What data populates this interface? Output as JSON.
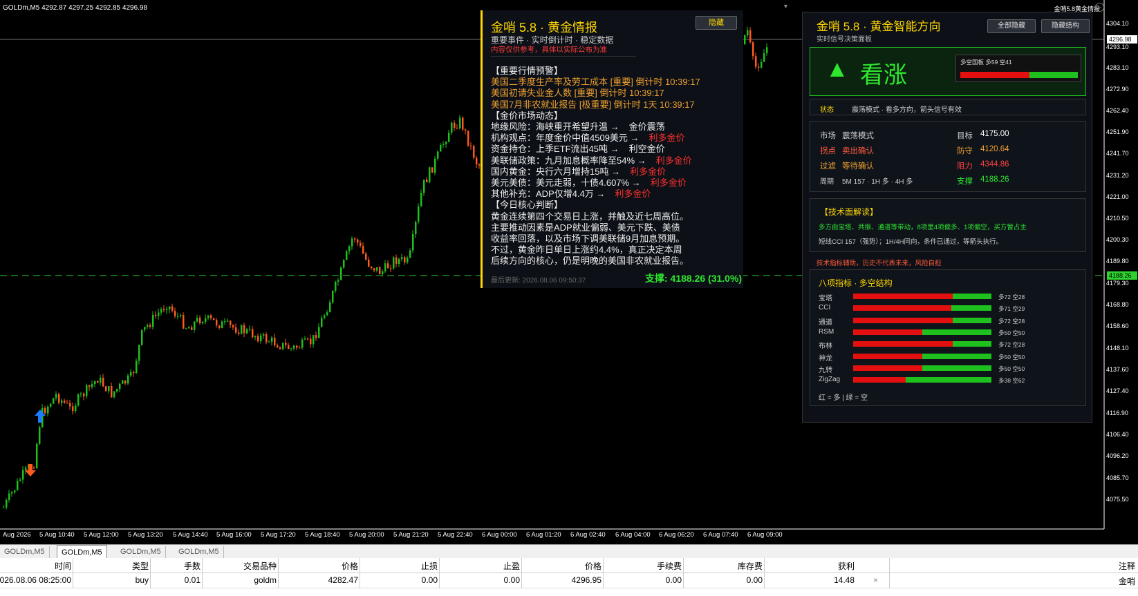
{
  "chart": {
    "symbol_info": "GOLDm,M5  4292.87 4297.25 4292.85 4296.98",
    "top_right_label": "金哨5.8黄金情报",
    "price_axis": [
      "4304.10",
      "4296.98",
      "4293.10",
      "4283.10",
      "4272.90",
      "4262.40",
      "4251.90",
      "4241.70",
      "4231.20",
      "4221.00",
      "4210.50",
      "4200.30",
      "4189.80",
      "4179.30",
      "4168.80",
      "4158.60",
      "4148.10",
      "4137.60",
      "4127.40",
      "4116.90",
      "4106.40",
      "4096.20",
      "4085.70",
      "4075.50"
    ],
    "current_price": "4296.98",
    "support_price_tag": "4188.26",
    "time_axis": [
      "Aug 2026",
      "5 Aug 10:40",
      "5 Aug 12:00",
      "5 Aug 13:20",
      "5 Aug 14:40",
      "5 Aug 16:00",
      "5 Aug 17:20",
      "5 Aug 18:40",
      "5 Aug 20:00",
      "5 Aug 21:20",
      "5 Aug 22:40",
      "6 Aug 00:00",
      "6 Aug 01:20",
      "6 Aug 02:40",
      "6 Aug 04:00",
      "6 Aug 06:20",
      "6 Aug 07:40",
      "6 Aug 09:00"
    ],
    "colors": {
      "bull": "#1ec01e",
      "bear": "#ff5a1e",
      "support": "#2ed12e"
    }
  },
  "news_panel": {
    "title": "金哨 5.8 · 黄金情报",
    "subtitle": "重要事件 · 实时倒计时 · 稳定数据",
    "warning": "内容仅供参考，具体以实际公布为准",
    "hide_button": "隐藏",
    "alert_header": "【重要行情预警】",
    "alerts": [
      "美国二季度生产率及劳工成本 [重要] 倒计时 10:39:17",
      "美国初请失业金人数 [重要] 倒计时 10:39:17",
      "美国7月非农就业报告 [极重要] 倒计时 1天 10:39:17"
    ],
    "market_header": "【金价市场动态】",
    "market": [
      {
        "text": "地缘风险：海峡重开希望升温  →",
        "impact": "金价震荡",
        "impact_color": "w"
      },
      {
        "text": "机构观点：年度金价中值4509美元  →",
        "impact": "利多金价",
        "impact_color": "r"
      },
      {
        "text": "资金持仓：上季ETF流出45吨  →",
        "impact": "利空金价",
        "impact_color": "g"
      },
      {
        "text": "美联储政策：九月加息概率降至54%  →",
        "impact": "利多金价",
        "impact_color": "r"
      },
      {
        "text": "国内黄金：央行六月增持15吨  →",
        "impact": "利多金价",
        "impact_color": "r"
      },
      {
        "text": "美元美债：美元走弱，十债4.607%  →",
        "impact": "利多金价",
        "impact_color": "r"
      },
      {
        "text": "其他补充：ADP仅增4.4万  →",
        "impact": "利多金价",
        "impact_color": "r"
      }
    ],
    "core_header": "【今日核心判断】",
    "core": [
      "黄金连续第四个交易日上涨，并触及近七周高位。",
      "主要推动因素是ADP就业偏弱、美元下跌、美债",
      "收益率回落，以及市场下调美联储9月加息预期。",
      "不过，黄金昨日单日上涨约4.4%，真正决定本周",
      "后续方向的核心，仍是明晚的美国非农就业报告。"
    ],
    "last_update": "最后更新: 2026.08.06 09:50:37",
    "support": "支撑: 4188.26 (31.0%)"
  },
  "signal_panel": {
    "title": "金哨 5.8 · 黄金智能方向",
    "subtitle": "实时信号决策面板",
    "btn_hide_all": "全部隐藏",
    "btn_hide_struct": "隐藏结构",
    "direction": "看涨",
    "ratio_label": "多空国板  多59 空41",
    "bull_pct": 59,
    "status_label": "状态",
    "status_value": "震荡模式 · 看多方向，箭头信号有效",
    "kv": {
      "market_l": "市场",
      "market_v": "震荡模式",
      "target_l": "目标",
      "target_v": "4175.00",
      "turn_l": "拐点",
      "turn_v": "卖出确认",
      "def_l": "防守",
      "def_v": "4120.64",
      "filter_l": "过滤",
      "filter_v": "等待确认",
      "res_l": "阻力",
      "res_v": "4344.86",
      "period_l": "周期",
      "period_v": "5M 157 · 1H 多 · 4H 多",
      "sup_l": "支撑",
      "sup_v": "4188.26"
    },
    "tech_header": "【技术面解读】",
    "tech1": "多方由宝塔、共振、通道等带动，8项里4项偏多、1项偏空，买方暂占主",
    "tech2": "短线CCI 157（强势）；1H/4H同向，条件已通过，等箭头执行。",
    "disclaimer": "技术指标辅助，历史不代表未来，风险自担",
    "ind_header": "八项指标 · 多空结构",
    "indicators": [
      {
        "name": "宝塔",
        "label": "多72 空28",
        "bull": 72
      },
      {
        "name": "CCI",
        "label": "多71 空29",
        "bull": 71
      },
      {
        "name": "通道",
        "label": "多72 空28",
        "bull": 72
      },
      {
        "name": "RSM",
        "label": "多50 空50",
        "bull": 50
      },
      {
        "name": "布林",
        "label": "多72 空28",
        "bull": 72
      },
      {
        "name": "神龙",
        "label": "多50 空50",
        "bull": 50
      },
      {
        "name": "九转",
        "label": "多50 空50",
        "bull": 50
      },
      {
        "name": "ZigZag",
        "label": "多38 空62",
        "bull": 38
      }
    ],
    "legend": "红 = 多  |  绿 = 空"
  },
  "tabs": [
    "GOLDm,M5",
    "GOLDm,M5",
    "GOLDm,M5",
    "GOLDm,M5"
  ],
  "active_tab": 1,
  "trade_table": {
    "headers": [
      "时间",
      "类型",
      "手数",
      "交易品种",
      "价格",
      "止损",
      "止盈",
      "价格",
      "手续费",
      "库存费",
      "获利",
      "注释"
    ],
    "row": [
      "2026.08.06 08:25:00",
      "buy",
      "0.01",
      "goldm",
      "4282.47",
      "0.00",
      "0.00",
      "4296.95",
      "0.00",
      "0.00",
      "14.48",
      "金哨"
    ]
  }
}
